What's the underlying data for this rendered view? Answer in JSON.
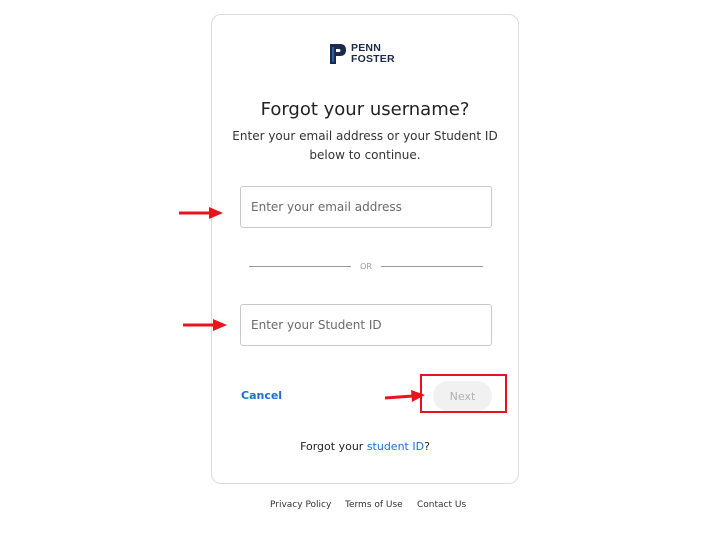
{
  "brand": {
    "line1": "PENN",
    "line2": "FOSTER"
  },
  "page": {
    "title": "Forgot your username?",
    "subtitle_line1": "Enter your email address or your Student ID",
    "subtitle_line2": "below to continue."
  },
  "form": {
    "email_placeholder": "Enter your email address",
    "email_value": "",
    "divider_label": "OR",
    "student_id_placeholder": "Enter your Student ID",
    "student_id_value": "",
    "cancel_label": "Cancel",
    "next_label": "Next",
    "next_enabled": false
  },
  "forgot": {
    "prefix": "Forgot your ",
    "link": "student ID",
    "suffix": "?"
  },
  "footer": {
    "privacy": "Privacy Policy",
    "terms": "Terms of Use",
    "contact": "Contact Us"
  },
  "colors": {
    "brand": "#1b2a4a",
    "link": "#1d6ed6",
    "annotation": "#e8141d"
  },
  "annotations": {
    "arrow_icon": "red-arrow-icon",
    "box_icon": "red-highlight-box"
  }
}
